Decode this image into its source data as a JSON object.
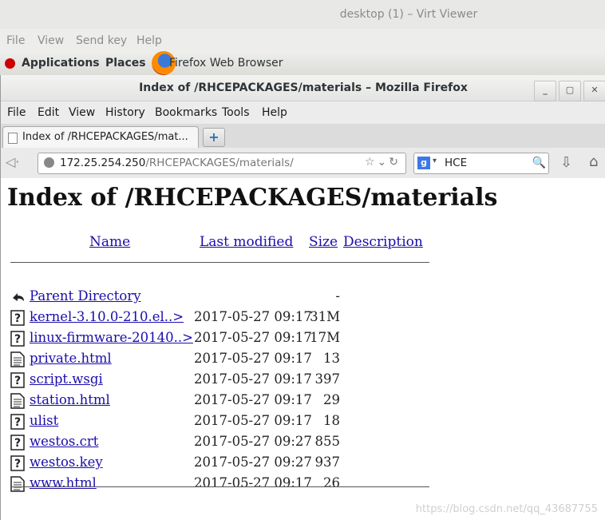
{
  "viewer": {
    "title": "desktop (1) – Virt Viewer",
    "menu": [
      "File",
      "View",
      "Send key",
      "Help"
    ]
  },
  "gnome_bar": {
    "applications": "Applications",
    "places": "Places",
    "active_app": "Firefox Web Browser"
  },
  "firefox": {
    "window_title": "Index of /RHCEPACKAGES/materials – Mozilla Firefox",
    "menu": [
      "File",
      "Edit",
      "View",
      "History",
      "Bookmarks",
      "Tools",
      "Help"
    ],
    "tab_label": "Index of /RHCEPACKAGES/mat...",
    "url_host": "172.25.254.250",
    "url_path": "/RHCEPACKAGES/materials/",
    "search_value": "HCE",
    "search_engine": "g"
  },
  "listing": {
    "heading": "Index of /RHCEPACKAGES/materials",
    "columns": {
      "name": "Name",
      "modified": "Last modified",
      "size": "Size",
      "description": "Description"
    },
    "rows": [
      {
        "icon": "back",
        "name": "Parent Directory",
        "modified": "",
        "size": "-"
      },
      {
        "icon": "unknown",
        "name": "kernel-3.10.0-210.el..>",
        "modified": "2017-05-27 09:17",
        "size": "31M"
      },
      {
        "icon": "unknown",
        "name": "linux-firmware-20140..>",
        "modified": "2017-05-27 09:17",
        "size": "17M"
      },
      {
        "icon": "text",
        "name": "private.html",
        "modified": "2017-05-27 09:17",
        "size": "13"
      },
      {
        "icon": "unknown",
        "name": "script.wsgi",
        "modified": "2017-05-27 09:17",
        "size": "397"
      },
      {
        "icon": "text",
        "name": "station.html",
        "modified": "2017-05-27 09:17",
        "size": "29"
      },
      {
        "icon": "unknown",
        "name": "ulist",
        "modified": "2017-05-27 09:17",
        "size": "18"
      },
      {
        "icon": "unknown",
        "name": "westos.crt",
        "modified": "2017-05-27 09:27",
        "size": "855"
      },
      {
        "icon": "unknown",
        "name": "westos.key",
        "modified": "2017-05-27 09:27",
        "size": "937"
      },
      {
        "icon": "text",
        "name": "www.html",
        "modified": "2017-05-27 09:17",
        "size": "26"
      }
    ]
  },
  "watermark": "https://blog.csdn.net/qq_43687755"
}
